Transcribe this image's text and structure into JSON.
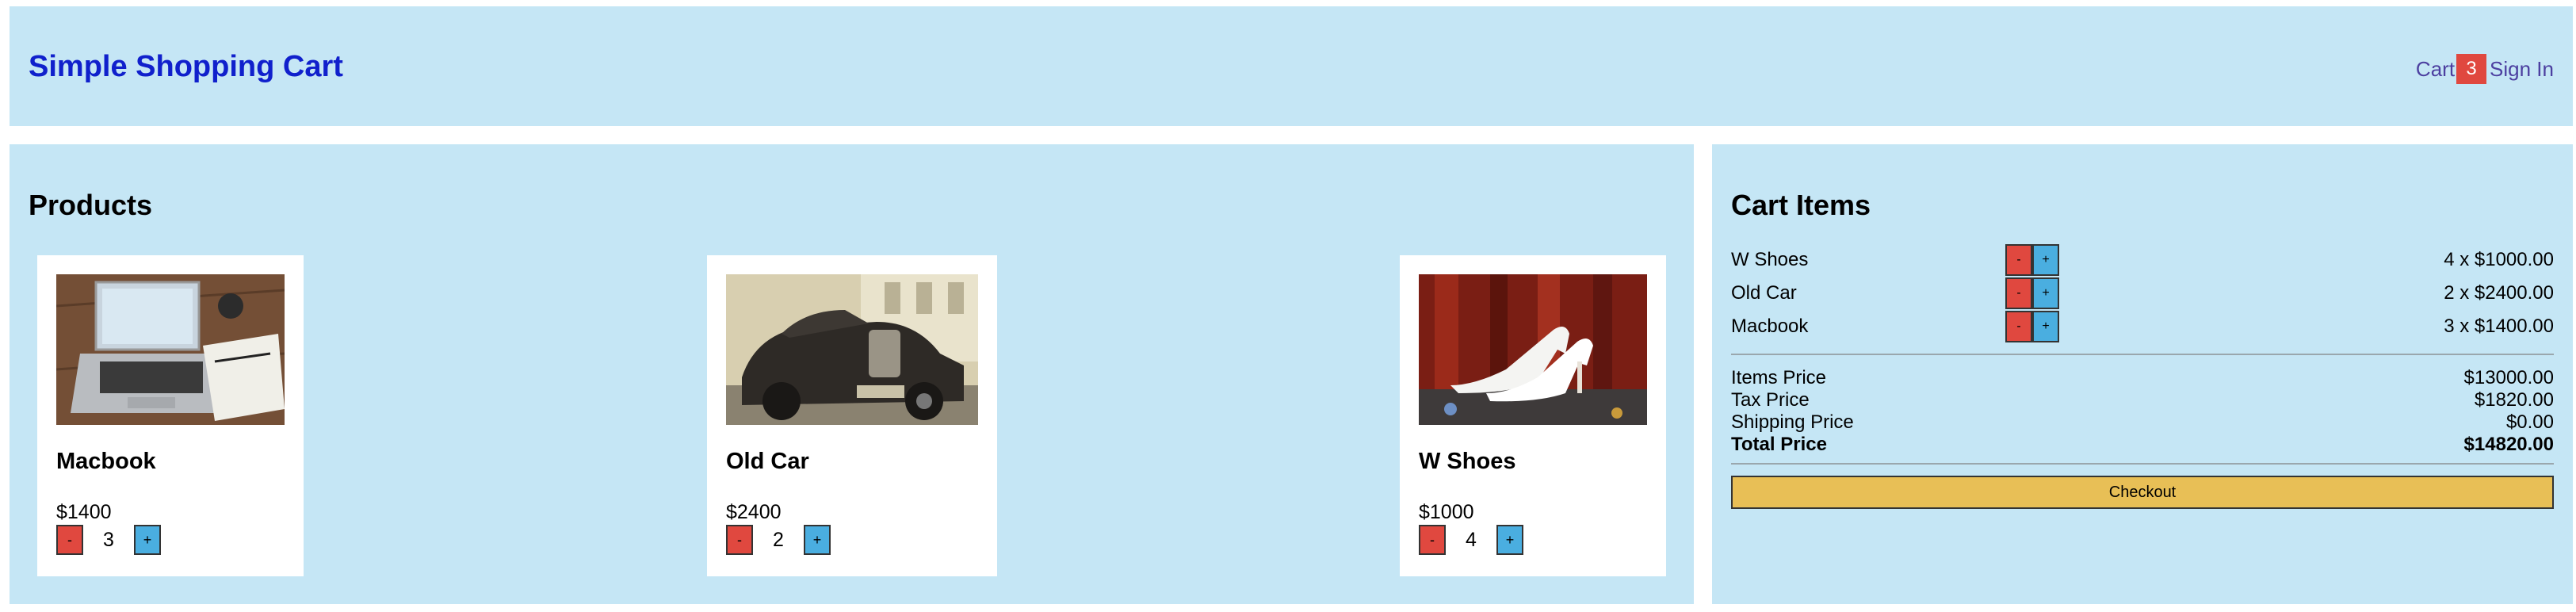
{
  "header": {
    "title": "Simple Shopping Cart",
    "cart_label": "Cart",
    "cart_count": "3",
    "sign_in_label": "Sign In"
  },
  "products": {
    "heading": "Products",
    "items": [
      {
        "name": "Macbook",
        "price": "$1400",
        "qty": "3",
        "minus": "-",
        "plus": "+",
        "image": "laptop-on-desk-image"
      },
      {
        "name": "Old Car",
        "price": "$2400",
        "qty": "2",
        "minus": "-",
        "plus": "+",
        "image": "vintage-car-image"
      },
      {
        "name": "W Shoes",
        "price": "$1000",
        "qty": "4",
        "minus": "-",
        "plus": "+",
        "image": "white-heels-image"
      }
    ]
  },
  "cart": {
    "heading": "Cart Items",
    "items": [
      {
        "name": "W Shoes",
        "amount": "4 x $1000.00",
        "minus": "-",
        "plus": "+"
      },
      {
        "name": "Old Car",
        "amount": "2 x $2400.00",
        "minus": "-",
        "plus": "+"
      },
      {
        "name": "Macbook",
        "amount": "3 x $1400.00",
        "minus": "-",
        "plus": "+"
      }
    ],
    "summary": {
      "items_price_label": "Items Price",
      "items_price": "$13000.00",
      "tax_price_label": "Tax Price",
      "tax_price": "$1820.00",
      "shipping_price_label": "Shipping Price",
      "shipping_price": "$0.00",
      "total_price_label": "Total Price",
      "total_price": "$14820.00"
    },
    "checkout_label": "Checkout"
  },
  "colors": {
    "panel_bg": "#c5e6f5",
    "brand": "#1020cc",
    "badge": "#e0483f",
    "minus_button": "#e0483f",
    "plus_button": "#4aaee0",
    "checkout_button": "#e8bf56"
  }
}
